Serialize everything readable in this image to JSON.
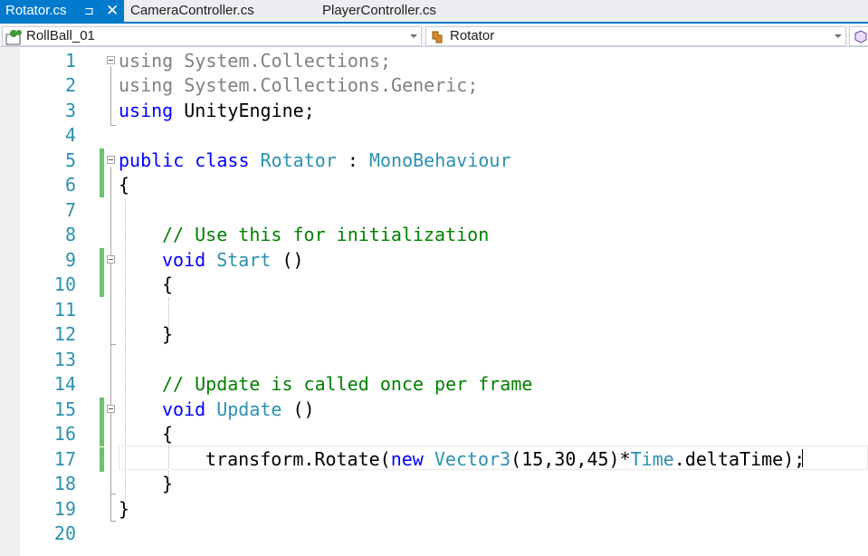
{
  "tabs": [
    {
      "label": "Rotator.cs",
      "active": true,
      "pin_glyph": "⊐",
      "close_glyph": "✕"
    },
    {
      "label": "CameraController.cs",
      "active": false
    },
    {
      "label": "PlayerController.cs",
      "active": false
    }
  ],
  "navbar": {
    "project": "RollBall_01",
    "type": "Rotator"
  },
  "colors": {
    "accent": "#007acc",
    "keyword": "#0000ff",
    "type": "#2b91af",
    "comment": "#008000",
    "line_number": "#2b91af",
    "change_marker": "#6cc26c"
  },
  "line_numbers": [
    "1",
    "2",
    "3",
    "4",
    "5",
    "6",
    "7",
    "8",
    "9",
    "10",
    "11",
    "12",
    "13",
    "14",
    "15",
    "16",
    "17",
    "18",
    "19",
    "20"
  ],
  "code": {
    "l1": {
      "kw": "using",
      "rest": " System.Collections;"
    },
    "l2": {
      "kw": "using",
      "rest": " System.Collections.Generic;"
    },
    "l3": {
      "kw": "using",
      "rest": " UnityEngine;"
    },
    "l5": {
      "kw1": "public",
      "kw2": " class",
      "name": " Rotator",
      "sep": " : ",
      "base": "MonoBehaviour"
    },
    "l6": {
      "text": "{"
    },
    "l8": {
      "comment": "// Use this for initialization"
    },
    "l9": {
      "kw": "void",
      "name": " Start",
      "rest": " ()"
    },
    "l10": {
      "text": "{"
    },
    "l12": {
      "text": "}"
    },
    "l14": {
      "comment": "// Update is called once per frame"
    },
    "l15": {
      "kw": "void",
      "name": " Update",
      "rest": " ()"
    },
    "l16": {
      "text": "{"
    },
    "l17": {
      "pre": "transform.Rotate(",
      "kw": "new",
      "space": " ",
      "type": "Vector3",
      "args": "(15,30,45)*",
      "type2": "Time",
      "post": ".deltaTime);"
    },
    "l18": {
      "text": "}"
    },
    "l19": {
      "text": "}"
    }
  }
}
